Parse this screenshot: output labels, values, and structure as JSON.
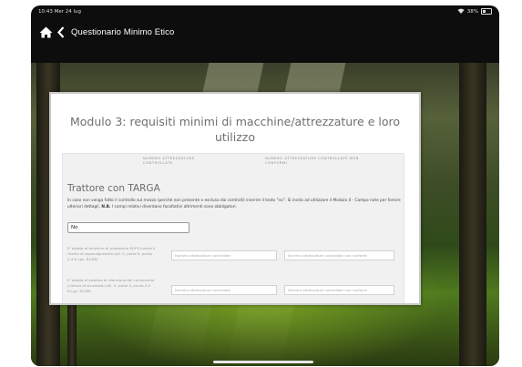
{
  "status_bar": {
    "time": "10:43",
    "date": "Mer 24 lug",
    "battery": "38%"
  },
  "app_bar": {
    "title": "Questionario Minimo Etico"
  },
  "module": {
    "title": "Modulo 3: requisiti minimi di macchine/attrezzature e loro utilizzo",
    "column_headers": [
      "NUMERO ATTREZZATURE CONTROLLATE",
      "NUMERO ATTREZZATURE CONTROLLATE NON CONFORMI"
    ],
    "section": {
      "title": "Trattore con TARGA",
      "description_intro": "In caso non venga fatto il controllo sul mezzo (perché non presente o escluso dai controlli) inserire il testo \"no\". Si invita ad utilizzare il Modulo 4 - Campo note per fornire ulteriori dettagli.",
      "description_nb_label": "N.B.",
      "description_nb": "I campi relativi diventano facoltativi altrimenti sono obbligatori.",
      "answer_value": "No",
      "rows": [
        {
          "label": "E' dotato di struttura di protezione ROPS contro il rischio di capovolgimento (All. V, parte II, punto 2.4 D.Lgs. 81/08)",
          "placeholder_controlled": "Numero attrezzature controllate",
          "placeholder_nonconforming": "Numero attrezzature controllate non conformi"
        },
        {
          "label": "E' dotato di sistema di ritenzione del conducente (cintura di sicurezza) (All. V, parte II, punto 2.4 D.Lgs. 81/08)",
          "placeholder_controlled": "Numero attrezzature controllate",
          "placeholder_nonconforming": "Numero attrezzature controllate non conformi"
        }
      ]
    }
  },
  "icons": {
    "home": "home-icon",
    "back": "chevron-left-icon",
    "wifi": "wifi-icon",
    "battery": "battery-icon"
  }
}
